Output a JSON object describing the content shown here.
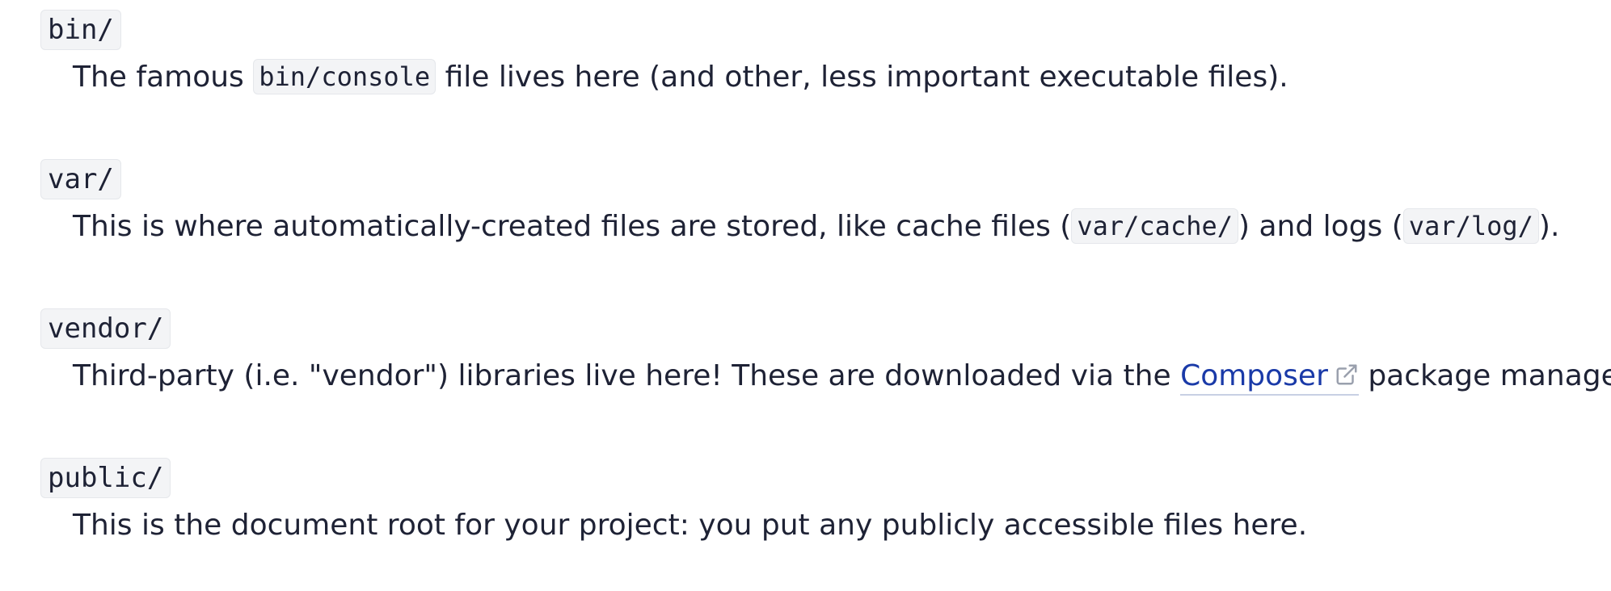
{
  "entries": [
    {
      "term": "bin/",
      "desc_before": "The famous ",
      "code": "bin/console",
      "desc_after": " file lives here (and other, less important executable files)."
    },
    {
      "term": "var/",
      "desc_before": "This is where automatically-created files are stored, like cache files (",
      "code1": "var/cache/",
      "desc_middle": ") and logs (",
      "code2": "var/log/",
      "desc_after": ")."
    },
    {
      "term": "vendor/",
      "desc_before": "Third-party (i.e. \"vendor\") libraries live here! These are downloaded via the ",
      "link_label": "Composer",
      "desc_after": " package manager."
    },
    {
      "term": "public/",
      "desc": "This is the document root for your project: you put any publicly accessible files here."
    }
  ],
  "icons": {
    "external_link": "external-link-icon"
  },
  "colors": {
    "text": "#1e2235",
    "link": "#1a3aa8",
    "code_bg": "#f3f4f6"
  }
}
